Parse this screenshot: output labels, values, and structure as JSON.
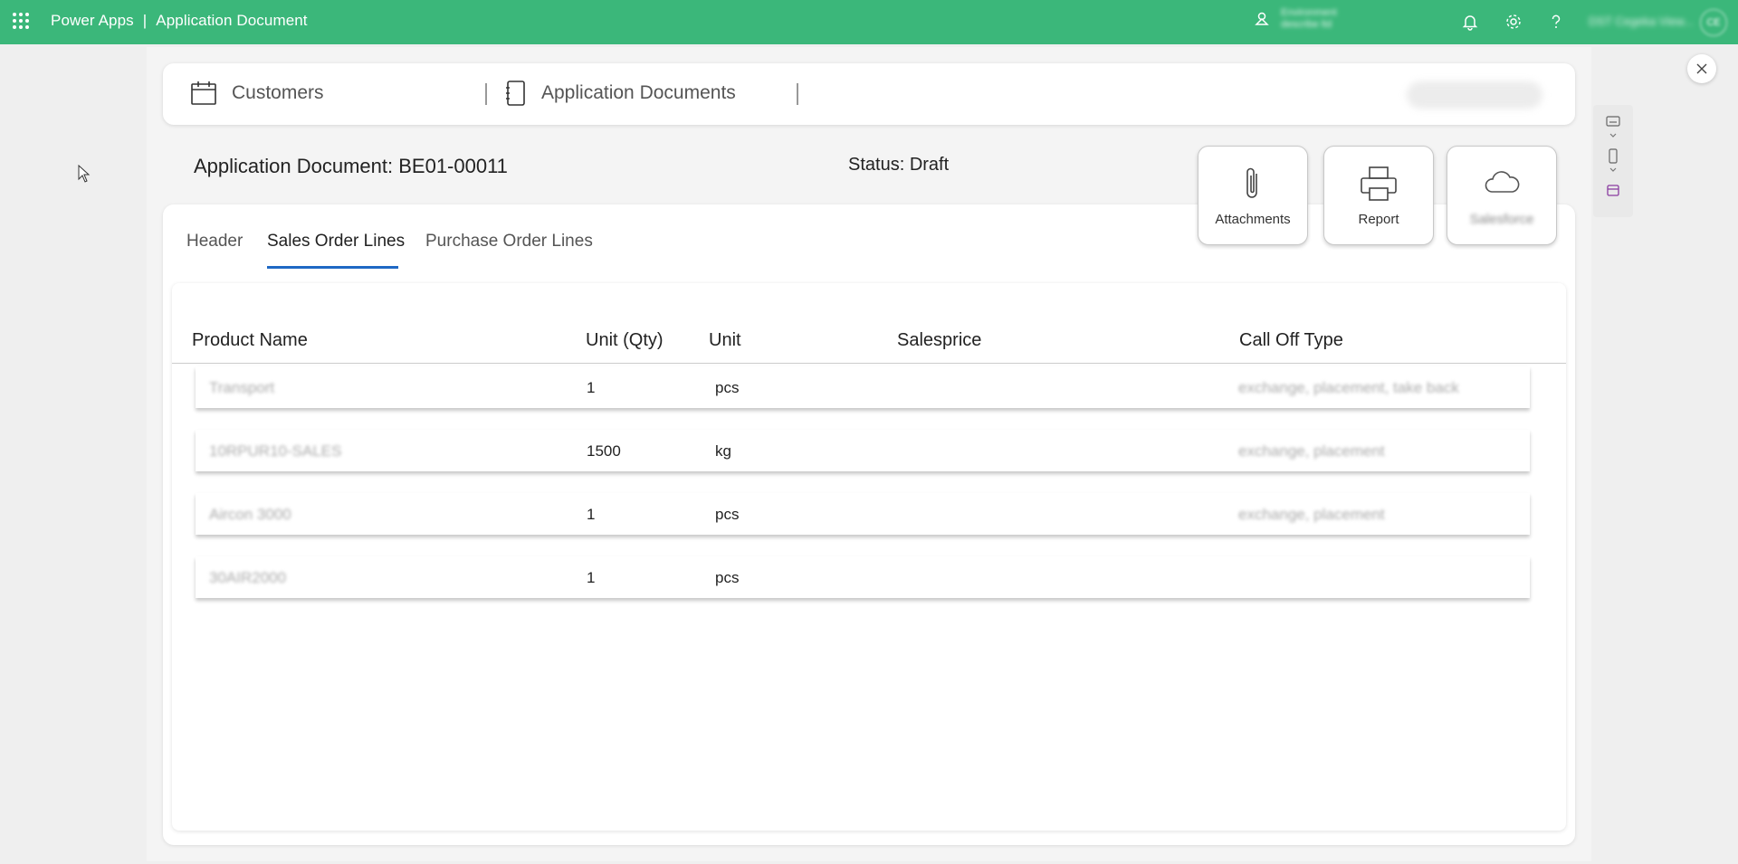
{
  "topbar": {
    "app_name": "Power Apps",
    "separator": "|",
    "page_name": "Application Document",
    "env_line1": "Environment",
    "env_line2": "describe ltd",
    "user_name": "DST Cegeka View...",
    "avatar_initials": "CE",
    "bg_color": "#3bb77a"
  },
  "nav": {
    "customers_label": "Customers",
    "documents_label": "Application Documents"
  },
  "document": {
    "title": "Application Document: BE01-00011",
    "status": "Status: Draft"
  },
  "actions": [
    {
      "label": "Attachments",
      "icon": "paperclip-icon"
    },
    {
      "label": "Report",
      "icon": "printer-icon"
    },
    {
      "label": "Salesforce",
      "icon": "cloud-icon"
    }
  ],
  "tabs": [
    {
      "label": "Header",
      "active": false
    },
    {
      "label": "Sales Order Lines",
      "active": true
    },
    {
      "label": "Purchase Order Lines",
      "active": false
    }
  ],
  "table": {
    "columns": [
      "Product Name",
      "Unit (Qty)",
      "Unit",
      "Salesprice",
      "Call Off Type"
    ],
    "rows": [
      {
        "product": "Transport",
        "qty": "1",
        "unit": "pcs",
        "salesprice": "",
        "call_off": "exchange, placement, take back"
      },
      {
        "product": "10RPUR10-SALES",
        "qty": "1500",
        "unit": "kg",
        "salesprice": "",
        "call_off": "exchange, placement"
      },
      {
        "product": "Aircon 3000",
        "qty": "1",
        "unit": "pcs",
        "salesprice": "",
        "call_off": "exchange, placement"
      },
      {
        "product": "30AIR2000",
        "qty": "1",
        "unit": "pcs",
        "salesprice": "",
        "call_off": ""
      }
    ]
  },
  "accent_color": "#1f68c4"
}
